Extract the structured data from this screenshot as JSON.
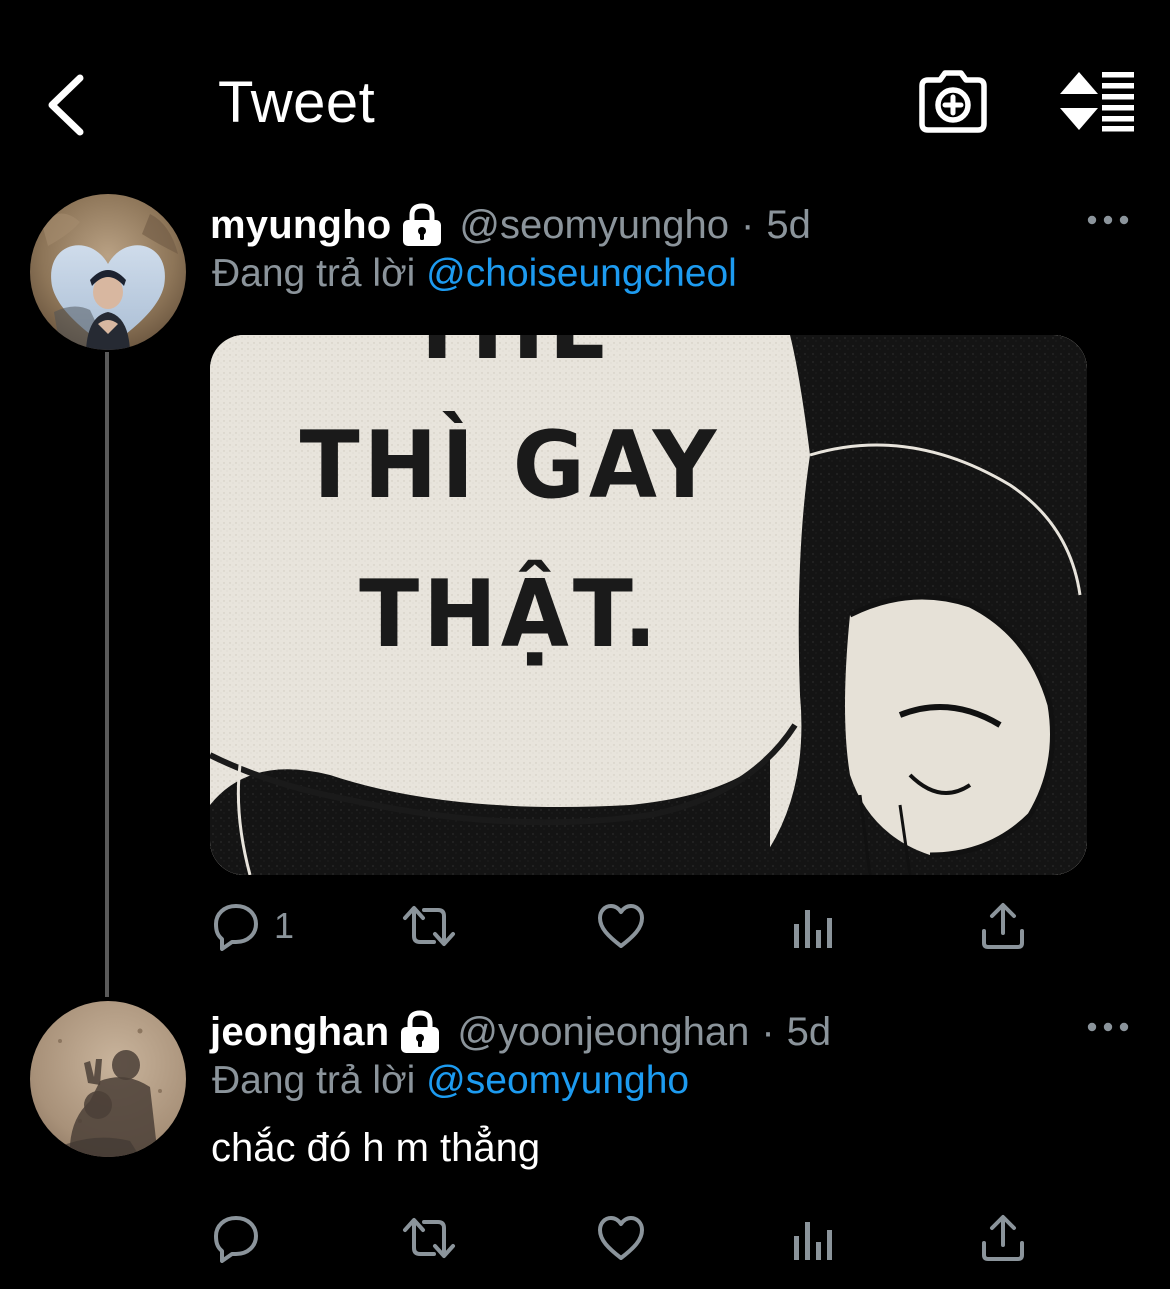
{
  "header": {
    "title": "Tweet",
    "back_icon": "chevron-left-icon",
    "camera_icon": "camera-plus-icon",
    "sort_icon": "sort-list-icon"
  },
  "tweets": [
    {
      "display_name": "myungho",
      "handle": "@seomyungho",
      "separator": "·",
      "time": "5d",
      "reply_prefix": "Đang trả lời",
      "reply_to": "@choiseungcheol",
      "media_text": [
        "THE",
        "THÌ GAY",
        "THẬT."
      ],
      "reply_count": "1",
      "protected": true
    },
    {
      "display_name": "jeonghan",
      "handle": "@yoonjeonghan",
      "separator": "·",
      "time": "5d",
      "reply_prefix": "Đang trả lời",
      "reply_to": "@seomyungho",
      "text": "chắc đó h m thẳng",
      "protected": true
    }
  ],
  "colors": {
    "background": "#000000",
    "text_primary": "#ffffff",
    "text_secondary": "#8b949b",
    "link": "#1d9bf0",
    "thread_line": "#5a5a5a"
  }
}
